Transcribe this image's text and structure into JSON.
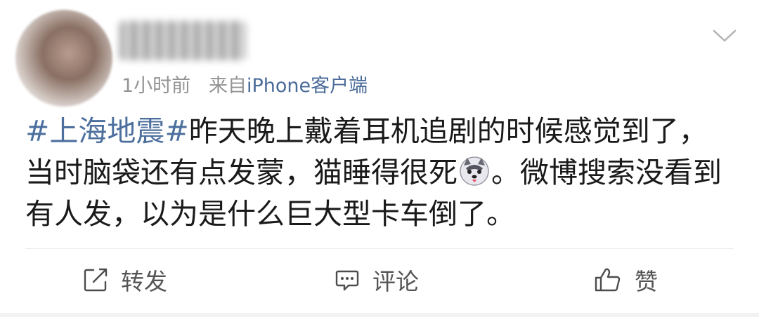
{
  "post": {
    "time": "1小时前",
    "source_prefix": "来自",
    "source_device": "iPhone客户端",
    "hashtag": "#上海地震#",
    "text_part1": "昨天晚上戴着耳机追剧的时候感觉到了，当时脑袋还有点发蒙，猫睡得很死",
    "text_part2": "。微博搜索没看到有人发，以为是什么巨大型卡车倒了。"
  },
  "actions": {
    "repost_label": "转发",
    "comment_label": "评论",
    "like_label": "赞"
  },
  "colors": {
    "link": "#4c6f9e",
    "meta": "#939393",
    "text": "#1a1a1a"
  },
  "icons": [
    "chevron-down-icon",
    "husky-emoji-icon",
    "repost-icon",
    "comment-icon",
    "like-icon"
  ]
}
